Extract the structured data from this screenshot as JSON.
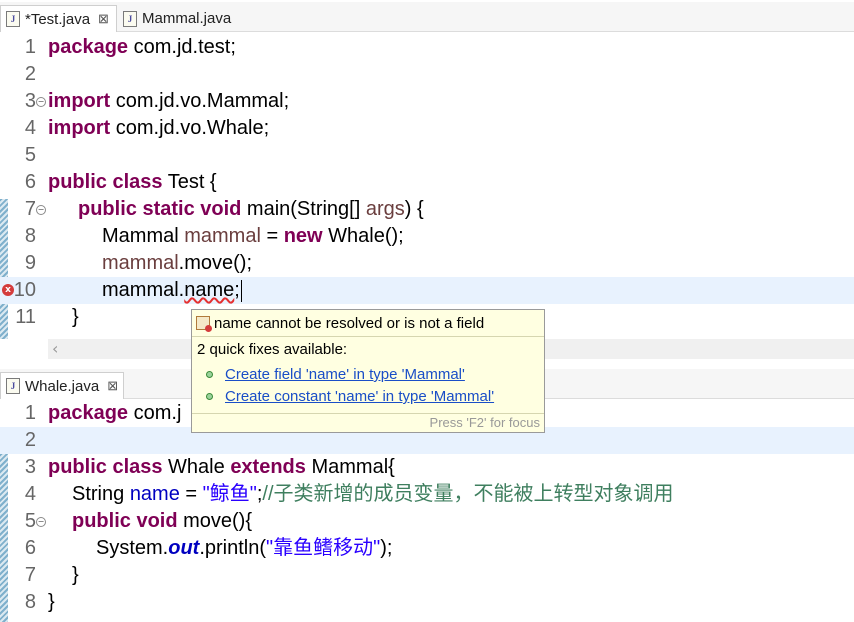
{
  "top_tabs": [
    {
      "label": "*Test.java",
      "close": "⊠"
    },
    {
      "label": "Mammal.java"
    }
  ],
  "test_lines": [
    {
      "n": "1"
    },
    {
      "n": "2"
    },
    {
      "n": "3"
    },
    {
      "n": "4"
    },
    {
      "n": "5"
    },
    {
      "n": "6"
    },
    {
      "n": "7"
    },
    {
      "n": "8"
    },
    {
      "n": "9"
    },
    {
      "n": "10"
    },
    {
      "n": "11"
    }
  ],
  "test_code": {
    "l1_kw": "package",
    "l1_rest": " com.jd.test;",
    "l3_kw": "import",
    "l3_rest": " com.jd.vo.Mammal;",
    "l4_kw": "import",
    "l4_rest": " com.jd.vo.Whale;",
    "l6_kw": "public class",
    "l6_rest": " Test {",
    "l7_kw": "public static void",
    "l7_a": " main(String[] ",
    "l7_var": "args",
    "l7_b": ") {",
    "l8_a": "Mammal ",
    "l8_var": "mammal",
    "l8_b": " = ",
    "l8_kw": "new",
    "l8_c": " Whale();",
    "l9_var": "mammal",
    "l9_rest": ".move();",
    "l10_a": "mammal.",
    "l10_err": "name",
    "l10_b": ";",
    "l11": "}"
  },
  "bottom_tab": {
    "label": "Whale.java",
    "close": "⊠"
  },
  "whale_lines": [
    {
      "n": "1"
    },
    {
      "n": "2"
    },
    {
      "n": "3"
    },
    {
      "n": "4"
    },
    {
      "n": "5"
    },
    {
      "n": "6"
    },
    {
      "n": "7"
    },
    {
      "n": "8"
    }
  ],
  "whale_code": {
    "l1_kw": "package",
    "l1_rest": " com.j",
    "l3_kw1": "public class",
    "l3_a": " Whale ",
    "l3_kw2": "extends",
    "l3_b": " Mammal{",
    "l4_a": "String ",
    "l4_fld": "name",
    "l4_b": " = ",
    "l4_str": "\"鲸鱼\"",
    "l4_c": ";",
    "l4_cmt": "//子类新增的成员变量，不能被上转型对象调用",
    "l5_kw": "public void",
    "l5_rest": " move(){",
    "l6_a": "System.",
    "l6_stat": "out",
    "l6_b": ".println(",
    "l6_str": "\"靠鱼鳍移动\"",
    "l6_c": ");",
    "l7": "}",
    "l8": "}"
  },
  "popup": {
    "title": "name cannot be resolved or is not a field",
    "subtitle": "2 quick fixes available:",
    "fixes": [
      "Create field 'name' in type 'Mammal'",
      "Create constant 'name' in type 'Mammal'"
    ],
    "footer": "Press 'F2' for focus"
  },
  "icons": {
    "file": "java-file-icon",
    "error": "error-icon",
    "fold": "fold-icon",
    "quickfix": "quickfix-icon"
  }
}
